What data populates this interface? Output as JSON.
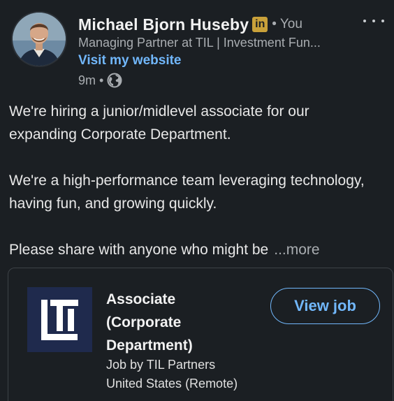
{
  "author": {
    "name": "Michael Bjorn Huseby",
    "badge": "in",
    "degree": "• You",
    "headline": "Managing Partner at TIL | Investment Fun...",
    "website_label": "Visit my website",
    "time_ago": "9m",
    "separator": "•",
    "visibility_icon": "globe-icon"
  },
  "post": {
    "paragraph_1": "We're hiring a junior/midlevel associate for our expanding Corporate Department.",
    "paragraph_2": "We're a high-performance team leveraging technology, having fun, and growing quickly.",
    "paragraph_3": "Please share with anyone who might be",
    "see_more_label": "...more"
  },
  "job": {
    "title": "Associate (Corporate Department)",
    "company_line": "Job by TIL Partners",
    "location": "United States (Remote)",
    "button_label": "View job",
    "logo_text": "TIL"
  },
  "colors": {
    "background": "#1b1f23",
    "link_blue": "#71b7fb",
    "premium_gold": "#c9a13a",
    "logo_navy": "#1f2a4d"
  }
}
